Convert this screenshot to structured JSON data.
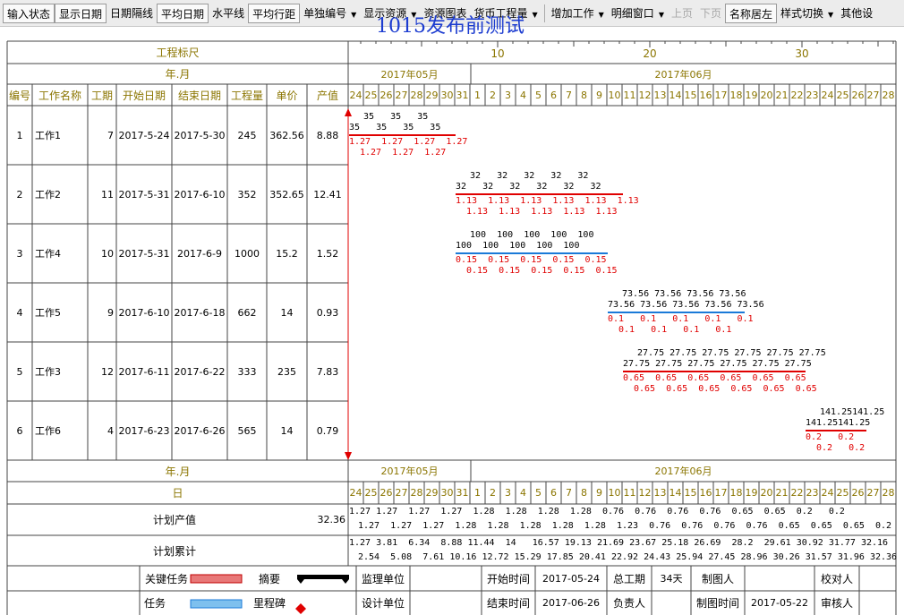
{
  "toolbar": [
    {
      "label": "输入状态",
      "pressed": true
    },
    {
      "label": "显示日期",
      "pressed": true
    },
    {
      "label": "日期隔线",
      "pressed": false
    },
    {
      "label": "平均日期",
      "pressed": true
    },
    {
      "label": "水平线",
      "pressed": false
    },
    {
      "label": "平均行距",
      "pressed": true
    },
    {
      "label": "单独编号",
      "dropdown": true
    },
    {
      "label": "显示资源",
      "dropdown": true
    },
    {
      "label": "资源图表"
    },
    {
      "label": "货币工程量",
      "dropdown": true
    },
    {
      "sep": true
    },
    {
      "label": "增加工作",
      "dropdown": true
    },
    {
      "label": "明细窗口",
      "dropdown": true
    },
    {
      "label": "上页",
      "disabled": true
    },
    {
      "label": "下页",
      "disabled": true
    },
    {
      "label": "名称居左",
      "pressed": true
    },
    {
      "label": "样式切换",
      "dropdown": true
    },
    {
      "label": "其他设"
    }
  ],
  "title": "1015发布前测试",
  "scale": {
    "label": "工程标尺",
    "ticks": [
      "10",
      "20",
      "30"
    ]
  },
  "month_header": {
    "label": "年.月",
    "months": [
      "2017年05月",
      "2017年06月"
    ]
  },
  "day_header": {
    "label": "日"
  },
  "days": [
    "24",
    "25",
    "26",
    "27",
    "28",
    "29",
    "30",
    "31",
    "1",
    "2",
    "3",
    "4",
    "5",
    "6",
    "7",
    "8",
    "9",
    "10",
    "11",
    "12",
    "13",
    "14",
    "15",
    "16",
    "17",
    "18",
    "19",
    "20",
    "21",
    "22",
    "23",
    "24",
    "25",
    "26",
    "27",
    "28"
  ],
  "columns": [
    "编号",
    "工作名称",
    "工期",
    "开始日期",
    "结束日期",
    "工程量",
    "单价",
    "产值"
  ],
  "rows": [
    {
      "id": "1",
      "name": "工作1",
      "duration": "7",
      "start": "2017-5-24",
      "end": "2017-5-30",
      "qty": "245",
      "price": "362.56",
      "value": "8.88",
      "bar": {
        "start": 0,
        "len": 7,
        "color": "#e00000",
        "top": "35   35   35",
        "mid": "35   35   35   35",
        "r1": "1.27  1.27  1.27  1.27",
        "r2": "1.27  1.27  1.27"
      }
    },
    {
      "id": "2",
      "name": "工作2",
      "duration": "11",
      "start": "2017-5-31",
      "end": "2017-6-10",
      "qty": "352",
      "price": "352.65",
      "value": "12.41",
      "bar": {
        "start": 7,
        "len": 11,
        "color": "#e00000",
        "top": "32   32   32   32   32",
        "mid": "32   32   32   32   32   32",
        "r1": "1.13  1.13  1.13  1.13  1.13  1.13",
        "r2": "1.13  1.13  1.13  1.13  1.13"
      }
    },
    {
      "id": "3",
      "name": "工作4",
      "duration": "10",
      "start": "2017-5-31",
      "end": "2017-6-9",
      "qty": "1000",
      "price": "15.2",
      "value": "1.52",
      "bar": {
        "start": 7,
        "len": 10,
        "color": "#1a7ad8",
        "top": "100  100  100  100  100",
        "mid": "100  100  100  100  100",
        "r1": "0.15  0.15  0.15  0.15  0.15",
        "r2": "0.15  0.15  0.15  0.15  0.15"
      }
    },
    {
      "id": "4",
      "name": "工作5",
      "duration": "9",
      "start": "2017-6-10",
      "end": "2017-6-18",
      "qty": "662",
      "price": "14",
      "value": "0.93",
      "bar": {
        "start": 17,
        "len": 9,
        "color": "#1a7ad8",
        "top": "73.56 73.56 73.56 73.56",
        "mid": "73.56 73.56 73.56 73.56 73.56",
        "r1": "0.1   0.1   0.1   0.1   0.1",
        "r2": "0.1   0.1   0.1   0.1"
      }
    },
    {
      "id": "5",
      "name": "工作3",
      "duration": "12",
      "start": "2017-6-11",
      "end": "2017-6-22",
      "qty": "333",
      "price": "235",
      "value": "7.83",
      "bar": {
        "start": 18,
        "len": 12,
        "color": "#e00000",
        "top": "27.75 27.75 27.75 27.75 27.75 27.75",
        "mid": "27.75 27.75 27.75 27.75 27.75 27.75",
        "r1": "0.65  0.65  0.65  0.65  0.65  0.65",
        "r2": "0.65  0.65  0.65  0.65  0.65  0.65"
      }
    },
    {
      "id": "6",
      "name": "工作6",
      "duration": "4",
      "start": "2017-6-23",
      "end": "2017-6-26",
      "qty": "565",
      "price": "14",
      "value": "0.79",
      "bar": {
        "start": 30,
        "len": 4,
        "color": "#e00000",
        "top": "141.25141.25",
        "mid": "141.25141.25",
        "r1": "0.2   0.2",
        "r2": "0.2   0.2"
      }
    }
  ],
  "plan_value": {
    "label": "计划产值",
    "total": "32.36",
    "line1": "1.27 1.27  1.27  1.27  1.28  1.28  1.28  1.28  0.76  0.76  0.76  0.76  0.65  0.65  0.2   0.2",
    "line2": "1.27  1.27  1.27  1.28  1.28  1.28  1.28  1.28  1.23  0.76  0.76  0.76  0.76  0.65  0.65  0.65  0.2   0.2"
  },
  "plan_cum": {
    "label": "计划累计",
    "line1": "1.27 3.81  6.34  8.88 11.44  14   16.57 19.13 21.69 23.67 25.18 26.69  28.2  29.61 30.92 31.77 32.16",
    "line2": "2.54  5.08  7.61 10.16 12.72 15.29 17.85 20.41 22.92 24.43 25.94 27.45 28.96 30.26 31.57 31.96 32.36"
  },
  "legend": {
    "critical": "关键任务",
    "summary": "摘要",
    "task": "任务",
    "milestone": "里程碑"
  },
  "info": {
    "supervise": "监理单位",
    "design": "设计单位",
    "start_label": "开始时间",
    "start_value": "2017-05-24",
    "end_label": "结束时间",
    "end_value": "2017-06-26",
    "total_label": "总工期",
    "total_value": "34天",
    "owner_label": "负责人",
    "maker_label": "制图人",
    "make_time_label": "制图时间",
    "make_time_value": "2017-05-22",
    "checker_label": "校对人",
    "auditor_label": "审核人"
  }
}
